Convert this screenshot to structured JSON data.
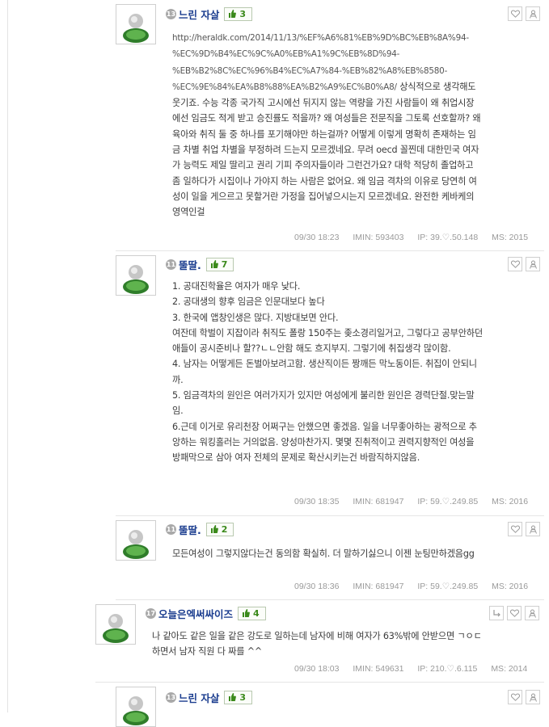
{
  "comments": [
    {
      "level": "13",
      "nick": "느린 자살",
      "likes": "3",
      "url": "http://heraldk.com/2014/11/13/%EF%A6%81%EB%9D%BC%EB%8A%94-%EC%9D%B4%EC%9C%A0%EB%A1%9C%EB%8D%94-%EB%B2%8C%EC%96%B4%EC%A7%84-%EB%82%A8%EB%8580-%EC%9E%84%EA%B8%88%EA%B2%A9%EC%B0%A8/",
      "text": "상식적으로 생각해도 웃기죠. 수능 각종 국가직 고시에선 뒤지지 않는 역량을 가진 사람들이 왜 취업시장에선 임금도 적게 받고 승진률도 적을까? 왜 여성들은 전문직을 그토록 선호할까? 왜 육아와 취직 둘 중 하나를 포기해야만 하는걸까? 어떻게 이렇게 명확히 존재하는 임금 차별 취업 차별을 부정하려 드는지 모르겠네요. 무려 oecd 꼴찐데 대한민국 여자가 능력도 제일 딸리고 권리 기피 주의자들이라 그런건가요? 대학 적당히 졸업하고 좀 일하다가 시집이나 가야지 하는 사람은 없어요. 왜 임금 격차의 이유로 당연히 여성이 일을 게으르고 못할거란 가정을 집어넣으시는지 모르겠네요. 완전한 케바케의 영역인걸",
      "date": "09/30 18:23",
      "imin": "IMIN: 593403",
      "ip": "IP: 39.♡.50.148",
      "ms": "MS: 2015"
    },
    {
      "level": "11",
      "nick": "뚤딸.",
      "likes": "7",
      "text": "1. 공대진학율은 여자가 매우 낮다.\n2. 공대생의 향후 임금은 인문대보다 높다\n3. 한국에 앱창인생은 많다. 지방대보면 안다.\n여잔데 학벌이 지잡이라 취직도 폴랑 150주는 좆소경리일거고, 그렇다고 공부안하던애들이 공시준비나 할??ㄴㄴ안함 해도 흐지부지. 그렇기에 취집생각 많이함.\n4. 남자는 어떻게든 돈벌아보려고함. 생산직이든 짱깨든 막노동이든. 취집이 안되니까.\n5. 임금격차의 원인은 여러가지가 있지만 여성에게 불리한 원인은 경력단절.맞는말임.\n6.근데 이거로 유리천장 어쩌구는 안했으면 좋겠음. 일을 너무좋아하는 광적으로 추앙하는 워킹홀러는 거의없음. 양성마찬가지. 몇몇 진취적이고 권력지향적인 여성을 방패막으로 삼아 여자 전체의 문제로 확산시키는건 바람직하지않음.",
      "date": "09/30 18:35",
      "imin": "IMIN: 681947",
      "ip": "IP: 59.♡.249.85",
      "ms": "MS: 2016"
    },
    {
      "level": "11",
      "nick": "뚤딸.",
      "likes": "2",
      "text": "모든여성이 그렇지않다는건 동의함 확실히. 더 말하기싫으니 이젠 눈팅만하겠음gg",
      "date": "09/30 18:36",
      "imin": "IMIN: 681947",
      "ip": "IP: 59.♡.249.85",
      "ms": "MS: 2016"
    },
    {
      "level": "17",
      "nick": "오늘은엑써싸이즈",
      "likes": "4",
      "text": "나 같아도 같은 일을 같은 강도로 일하는데 남자에 비해 여자가 63%밖에 안받으면 ㄱㅇㄷ하면서 남자 직원 다 짜를 ^^",
      "date": "09/30 18:03",
      "imin": "IMIN: 549631",
      "ip": "IP: 210.♡.6.115",
      "ms": "MS: 2014"
    },
    {
      "level": "13",
      "nick": "느린 자살",
      "likes": "3"
    }
  ],
  "icons": {
    "like": "thumbs-up-icon",
    "heart": "heart-icon",
    "report": "report-person-icon",
    "reply": "reply-arrow-icon"
  },
  "colors": {
    "nick": "#1b3d8f",
    "likes": "#3b8a1b",
    "meta": "#9a9a9a"
  }
}
